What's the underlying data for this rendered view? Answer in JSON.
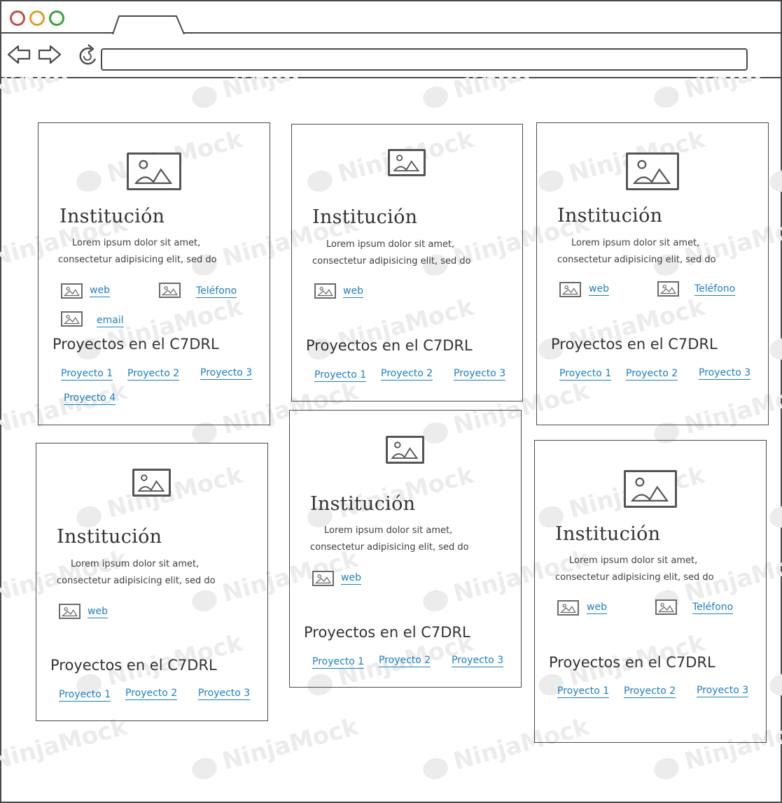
{
  "browser": {
    "url": ""
  },
  "watermark": "NinjaMock",
  "cards": [
    {
      "title": "Institución",
      "desc_line1": "Lorem ipsum dolor sit amet,",
      "desc_line2": "consectetur adipisicing elit, sed do",
      "contacts": [
        "web",
        "Teléfono",
        "email"
      ],
      "section_title": "Proyectos en el C7DRL",
      "projects": [
        "Proyecto 1",
        "Proyecto 2",
        "Proyecto 3",
        "Proyecto 4"
      ]
    },
    {
      "title": "Institución",
      "desc_line1": "Lorem ipsum dolor sit amet,",
      "desc_line2": "consectetur adipisicing elit, sed do",
      "contacts": [
        "web"
      ],
      "section_title": "Proyectos en el C7DRL",
      "projects": [
        "Proyecto 1",
        "Proyecto 2",
        "Proyecto 3"
      ]
    },
    {
      "title": "Institución",
      "desc_line1": "Lorem ipsum dolor sit amet,",
      "desc_line2": "consectetur adipisicing elit, sed do",
      "contacts": [
        "web",
        "Teléfono"
      ],
      "section_title": "Proyectos en el C7DRL",
      "projects": [
        "Proyecto 1",
        "Proyecto 2",
        "Proyecto 3"
      ]
    },
    {
      "title": "Institución",
      "desc_line1": "Lorem ipsum dolor sit amet,",
      "desc_line2": "consectetur adipisicing elit, sed do",
      "contacts": [
        "web"
      ],
      "section_title": "Proyectos en el C7DRL",
      "projects": [
        "Proyecto 1",
        "Proyecto 2",
        "Proyecto 3"
      ]
    },
    {
      "title": "Institución",
      "desc_line1": "Lorem ipsum dolor sit amet,",
      "desc_line2": "consectetur adipisicing elit, sed do",
      "contacts": [
        "web"
      ],
      "section_title": "Proyectos en el C7DRL",
      "projects": [
        "Proyecto 1",
        "Proyecto 2",
        "Proyecto 3"
      ]
    },
    {
      "title": "Institución",
      "desc_line1": "Lorem ipsum dolor sit amet,",
      "desc_line2": "consectetur adipisicing elit, sed do",
      "contacts": [
        "web",
        "Teléfono"
      ],
      "section_title": "Proyectos en el C7DRL",
      "projects": [
        "Proyecto 1",
        "Proyecto 2",
        "Proyecto 3"
      ]
    }
  ]
}
